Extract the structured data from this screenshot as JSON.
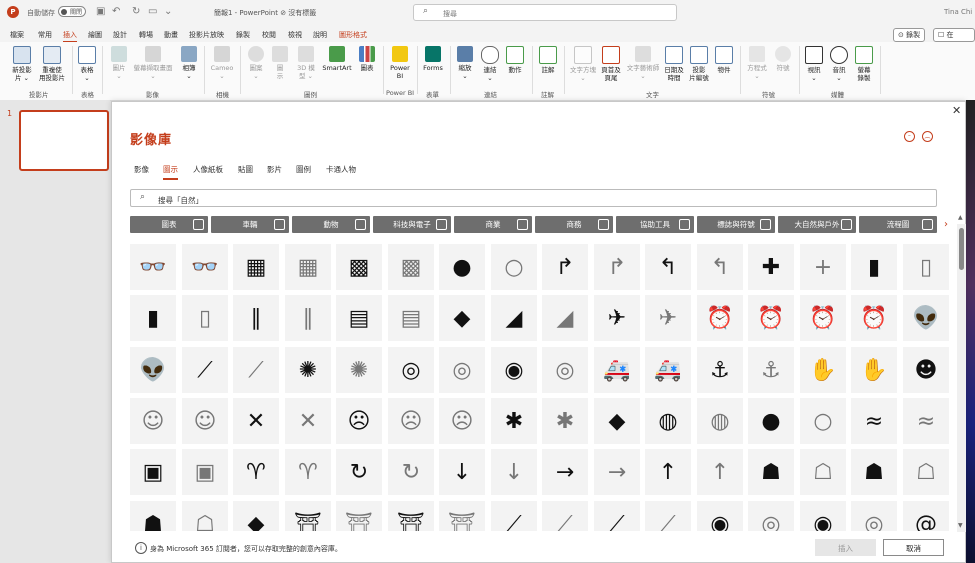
{
  "titlebar": {
    "autosave_label": "自動儲存",
    "autosave_state": "關閉",
    "doc_name": "簡報1 - PowerPoint  ⊘ 沒有標籤",
    "search_placeholder": "搜尋",
    "user": "Tina Chi"
  },
  "ribbon_tabs": [
    "檔案",
    "常用",
    "插入",
    "繪圖",
    "設計",
    "轉場",
    "動畫",
    "投影片放映",
    "錄製",
    "校閱",
    "檢視",
    "說明",
    "圖形格式"
  ],
  "active_tab": "插入",
  "ribbon_right": {
    "record": "⊙ 錄製",
    "share": "☐ 在 Team"
  },
  "ribbon_items": [
    {
      "label": "新投影\n片 ⌄"
    },
    {
      "label": "重複使\n用投影片"
    },
    {
      "label": "表格\n⌄"
    },
    {
      "label": "圖片\n⌄"
    },
    {
      "label": "螢幕擷取畫面\n⌄"
    },
    {
      "label": "相簿\n⌄"
    },
    {
      "label": "Cameo\n⌄"
    },
    {
      "label": "圖案\n⌄"
    },
    {
      "label": "圖\n示"
    },
    {
      "label": "3D 模\n型 ⌄"
    },
    {
      "label": "SmartArt"
    },
    {
      "label": "圖表"
    },
    {
      "label": "Power\nBI"
    },
    {
      "label": "Forms"
    },
    {
      "label": "縮放\n⌄"
    },
    {
      "label": "連結\n⌄"
    },
    {
      "label": "動作"
    },
    {
      "label": "註解"
    },
    {
      "label": "文字方塊\n⌄"
    },
    {
      "label": "頁首及\n頁尾"
    },
    {
      "label": "文字藝術師\n⌄"
    },
    {
      "label": "日期及\n時間"
    },
    {
      "label": "投影\n片編號"
    },
    {
      "label": "物件"
    },
    {
      "label": "方程式\n⌄"
    },
    {
      "label": "符號"
    },
    {
      "label": "視訊\n⌄"
    },
    {
      "label": "音訊\n⌄"
    },
    {
      "label": "螢幕\n錄製"
    }
  ],
  "ribbon_groups": [
    "投影片",
    "表格",
    "影像",
    "相機",
    "圖例",
    "Power BI",
    "表單",
    "連結",
    "註解",
    "文字",
    "符號",
    "媒體"
  ],
  "slide_number": "1",
  "dialog": {
    "title": "影像庫",
    "categories": [
      "影像",
      "圖示",
      "人像紙板",
      "貼圖",
      "影片",
      "圖例",
      "卡通人物"
    ],
    "active_category": "圖示",
    "search_placeholder": "搜尋「自然」",
    "chips": [
      {
        "label": "圖表"
      },
      {
        "label": "車輛"
      },
      {
        "label": "動物"
      },
      {
        "label": "科技與電子"
      },
      {
        "label": "商業"
      },
      {
        "label": "商務"
      },
      {
        "label": "協助工具"
      },
      {
        "label": "標誌與符號"
      },
      {
        "label": "大自然與戶外"
      },
      {
        "label": "流程圖"
      }
    ],
    "icons": [
      {
        "glyph": "👓",
        "name": "3d-glasses-icon",
        "outline": false
      },
      {
        "glyph": "👓",
        "name": "3d-glasses-outline-icon",
        "outline": true
      },
      {
        "glyph": "▦",
        "name": "abacus-icon",
        "outline": false
      },
      {
        "glyph": "▦",
        "name": "abacus-outline-icon",
        "outline": true
      },
      {
        "glyph": "▩",
        "name": "abacus-icon",
        "outline": false
      },
      {
        "glyph": "▩",
        "name": "abacus-outline-icon",
        "outline": true
      },
      {
        "glyph": "●",
        "name": "acorn-icon",
        "outline": false
      },
      {
        "glyph": "○",
        "name": "acorn-outline-icon",
        "outline": true
      },
      {
        "glyph": "↱",
        "name": "turn-right-arrow-icon",
        "outline": false
      },
      {
        "glyph": "↱",
        "name": "turn-right-arrow-outline-icon",
        "outline": true
      },
      {
        "glyph": "↰",
        "name": "turn-left-arrow-icon",
        "outline": false
      },
      {
        "glyph": "↰",
        "name": "turn-left-arrow-outline-icon",
        "outline": true
      },
      {
        "glyph": "✚",
        "name": "add-icon",
        "outline": false
      },
      {
        "glyph": "+",
        "name": "add-outline-icon",
        "outline": true
      },
      {
        "glyph": "▮",
        "name": "address-book-icon",
        "outline": false
      },
      {
        "glyph": "▯",
        "name": "address-book-outline-icon",
        "outline": true
      },
      {
        "glyph": "▮",
        "name": "address-book-icon",
        "outline": false
      },
      {
        "glyph": "▯",
        "name": "address-book-outline-icon",
        "outline": true
      },
      {
        "glyph": "∥",
        "name": "adhesive-bandage-icon",
        "outline": false
      },
      {
        "glyph": "∥",
        "name": "adhesive-bandage-outline-icon",
        "outline": true
      },
      {
        "glyph": "▤",
        "name": "billboard-icon",
        "outline": false
      },
      {
        "glyph": "▤",
        "name": "billboard-outline-icon",
        "outline": true
      },
      {
        "glyph": "◆",
        "name": "africa-icon",
        "outline": false
      },
      {
        "glyph": "◢",
        "name": "landscape-icon",
        "outline": false
      },
      {
        "glyph": "◢",
        "name": "landscape-outline-icon",
        "outline": true
      },
      {
        "glyph": "✈",
        "name": "airplane-icon",
        "outline": false
      },
      {
        "glyph": "✈",
        "name": "airplane-outline-icon",
        "outline": true
      },
      {
        "glyph": "⏰",
        "name": "alarm-clock-icon",
        "outline": false
      },
      {
        "glyph": "⏰",
        "name": "alarm-clock-outline-icon",
        "outline": true
      },
      {
        "glyph": "⏰",
        "name": "ringing-alarm-icon",
        "outline": false
      },
      {
        "glyph": "⏰",
        "name": "ringing-alarm-outline-icon",
        "outline": true
      },
      {
        "glyph": "👽",
        "name": "alien-icon",
        "outline": false
      },
      {
        "glyph": "👽",
        "name": "alien-outline-icon",
        "outline": true
      },
      {
        "glyph": "⟋",
        "name": "needle-icon",
        "outline": false
      },
      {
        "glyph": "⟋",
        "name": "needle-outline-icon",
        "outline": true
      },
      {
        "glyph": "✺",
        "name": "yarn-ball-icon",
        "outline": false
      },
      {
        "glyph": "✺",
        "name": "yarn-ball-outline-icon",
        "outline": true
      },
      {
        "glyph": "◎",
        "name": "measuring-tape-icon",
        "outline": false
      },
      {
        "glyph": "◎",
        "name": "measuring-tape-outline-icon",
        "outline": true
      },
      {
        "glyph": "◉",
        "name": "button-icon",
        "outline": false
      },
      {
        "glyph": "◎",
        "name": "button-outline-icon",
        "outline": true
      },
      {
        "glyph": "🚑",
        "name": "ambulance-icon",
        "outline": false
      },
      {
        "glyph": "🚑",
        "name": "ambulance-outline-icon",
        "outline": true
      },
      {
        "glyph": "⚓",
        "name": "anchor-icon",
        "outline": false
      },
      {
        "glyph": "⚓",
        "name": "anchor-outline-icon",
        "outline": true
      },
      {
        "glyph": "✋",
        "name": "coral-icon",
        "outline": false
      },
      {
        "glyph": "✋",
        "name": "coral-outline-icon",
        "outline": true
      },
      {
        "glyph": "☻",
        "name": "angel-face-icon",
        "outline": false
      },
      {
        "glyph": "☺",
        "name": "angel-face-outline-icon",
        "outline": true
      },
      {
        "glyph": "☺",
        "name": "grinning-face-outline-icon",
        "outline": true
      },
      {
        "glyph": "✕",
        "name": "angry-icon",
        "outline": false
      },
      {
        "glyph": "✕",
        "name": "angry-outline-icon",
        "outline": true
      },
      {
        "glyph": "☹",
        "name": "frowning-face-icon",
        "outline": false
      },
      {
        "glyph": "☹",
        "name": "frowning-face-outline-icon",
        "outline": true
      },
      {
        "glyph": "☹",
        "name": "angry-face-outline-icon",
        "outline": true
      },
      {
        "glyph": "✱",
        "name": "ant-icon",
        "outline": false
      },
      {
        "glyph": "✱",
        "name": "ant-outline-icon",
        "outline": true
      },
      {
        "glyph": "◆",
        "name": "antarctica-icon",
        "outline": false
      },
      {
        "glyph": "◍",
        "name": "aperture-icon",
        "outline": false
      },
      {
        "glyph": "◍",
        "name": "aperture-outline-icon",
        "outline": true
      },
      {
        "glyph": "●",
        "name": "apple-icon",
        "outline": false
      },
      {
        "glyph": "○",
        "name": "apple-outline-icon",
        "outline": true
      },
      {
        "glyph": "≈",
        "name": "aquarius-icon",
        "outline": false
      },
      {
        "glyph": "≈",
        "name": "aquarius-outline-icon",
        "outline": true
      },
      {
        "glyph": "▣",
        "name": "architect-drawing-icon",
        "outline": false
      },
      {
        "glyph": "▣",
        "name": "architect-drawing-outline-icon",
        "outline": true
      },
      {
        "glyph": "♈",
        "name": "aries-icon",
        "outline": false
      },
      {
        "glyph": "♈",
        "name": "aries-outline-icon",
        "outline": true
      },
      {
        "glyph": "↻",
        "name": "circular-arrows-icon",
        "outline": false
      },
      {
        "glyph": "↻",
        "name": "circular-arrows-outline-icon",
        "outline": true
      },
      {
        "glyph": "↓",
        "name": "arrow-down-icon",
        "outline": false
      },
      {
        "glyph": "↓",
        "name": "arrow-down-outline-icon",
        "outline": true
      },
      {
        "glyph": "→",
        "name": "arrow-right-icon",
        "outline": false
      },
      {
        "glyph": "→",
        "name": "arrow-right-outline-icon",
        "outline": true
      },
      {
        "glyph": "↑",
        "name": "arrow-up-icon",
        "outline": false
      },
      {
        "glyph": "↑",
        "name": "arrow-up-outline-icon",
        "outline": true
      },
      {
        "glyph": "☗",
        "name": "head-brain-icon",
        "outline": false
      },
      {
        "glyph": "☖",
        "name": "head-brain-outline-icon",
        "outline": true
      },
      {
        "glyph": "☗",
        "name": "artist-icon",
        "outline": false
      },
      {
        "glyph": "☖",
        "name": "artist-outline-icon",
        "outline": true
      },
      {
        "glyph": "☗",
        "name": "person-icon",
        "outline": false
      },
      {
        "glyph": "☖",
        "name": "person-outline-icon",
        "outline": true
      },
      {
        "glyph": "◆",
        "name": "asia-icon",
        "outline": false
      },
      {
        "glyph": "⛩",
        "name": "pagoda-icon",
        "outline": false
      },
      {
        "glyph": "⛩",
        "name": "pagoda-outline-icon",
        "outline": true
      },
      {
        "glyph": "⛩",
        "name": "temple-icon",
        "outline": false
      },
      {
        "glyph": "⛩",
        "name": "temple-outline-icon",
        "outline": true
      },
      {
        "glyph": "⟋",
        "name": "climber-icon",
        "outline": false
      },
      {
        "glyph": "⟋",
        "name": "climber-outline-icon",
        "outline": true
      },
      {
        "glyph": "⟋",
        "name": "athlete-icon",
        "outline": false
      },
      {
        "glyph": "⟋",
        "name": "athlete-outline-icon",
        "outline": true
      },
      {
        "glyph": "◉",
        "name": "astronaut-icon",
        "outline": false
      },
      {
        "glyph": "◎",
        "name": "astronaut-outline-icon",
        "outline": true
      },
      {
        "glyph": "◉",
        "name": "astronaut-helmet-icon",
        "outline": false
      },
      {
        "glyph": "◎",
        "name": "astronaut-helmet-outline-icon",
        "outline": true
      },
      {
        "glyph": "@",
        "name": "at-sign-icon",
        "outline": false
      }
    ]
  },
  "footer": {
    "info": "i",
    "text": "身為 Microsoft 365 訂閱者，您可以存取完整的創意內容庫。",
    "insert_label": "插入",
    "cancel_label": "取消"
  },
  "colors": {
    "accent": "#c43e1c",
    "chip_bg": "#6e6e6e",
    "cell_bg": "#f3f3f3"
  }
}
